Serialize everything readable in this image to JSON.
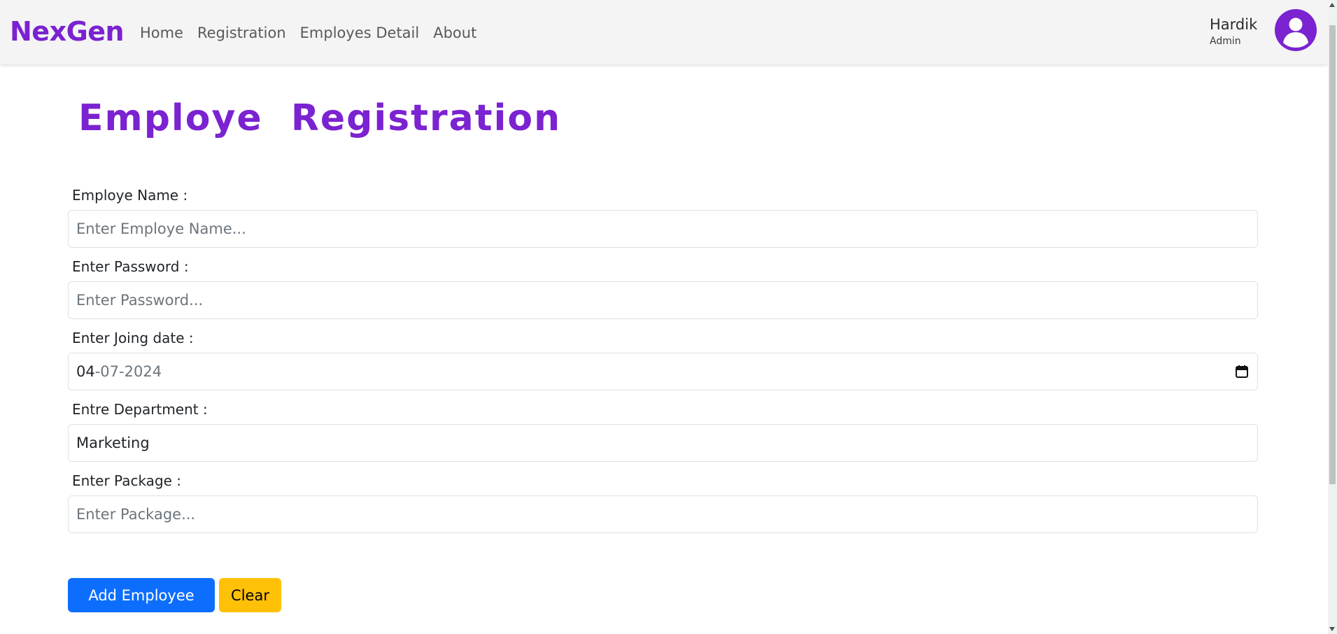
{
  "navbar": {
    "brand": "NexGen",
    "links": [
      "Home",
      "Registration",
      "Employes Detail",
      "About"
    ],
    "user": {
      "name": "Hardik",
      "role": "Admin"
    },
    "avatar_icon": "user-circle-icon"
  },
  "page": {
    "title": "Employe  Registration"
  },
  "form": {
    "fields": [
      {
        "label": "Employe Name :",
        "placeholder": "Enter Employe Name...",
        "value": ""
      },
      {
        "label": "Enter Password :",
        "placeholder": "Enter Password...",
        "value": ""
      },
      {
        "label": "Enter Joing date :",
        "value_day": "04",
        "value_rest": "-07-2024",
        "icon": "calendar-icon"
      },
      {
        "label": "Entre Department :",
        "value": "Marketing"
      },
      {
        "label": "Enter Package :",
        "placeholder": "Enter Package...",
        "value": ""
      }
    ],
    "add_button": "Add Employee",
    "clear_button": "Clear"
  },
  "colors": {
    "brand": "#7b22d1",
    "primary": "#0d6efd",
    "warning": "#ffc107"
  }
}
